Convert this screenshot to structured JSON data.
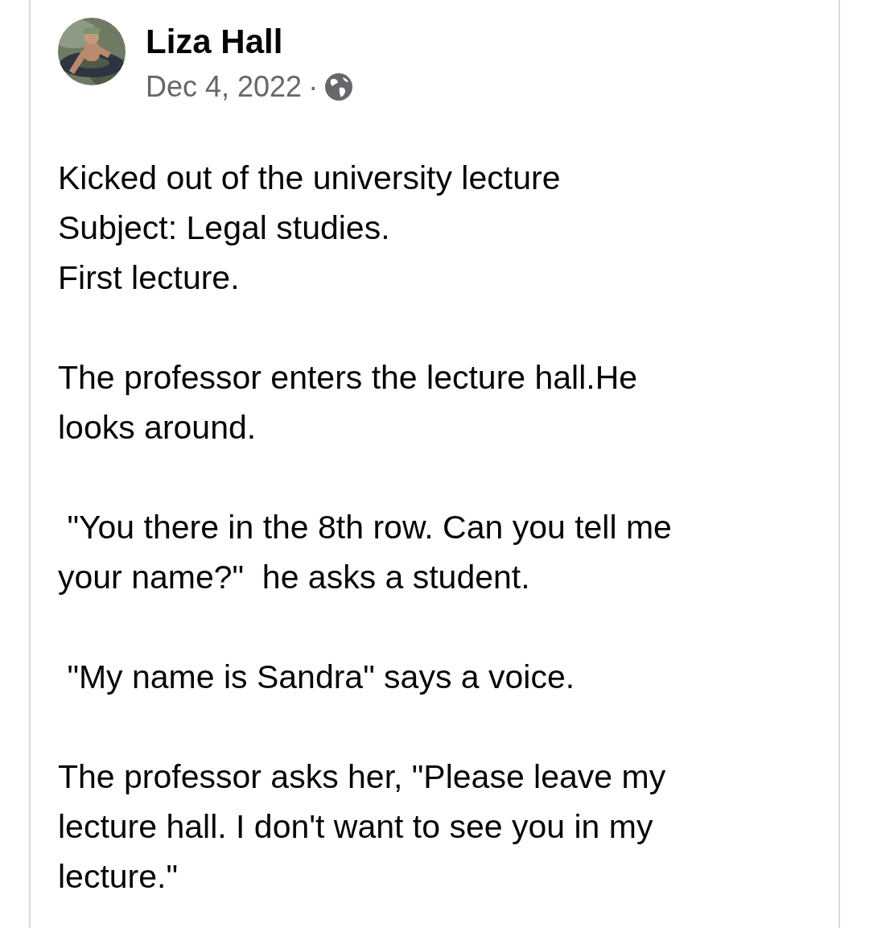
{
  "post": {
    "author": {
      "name": "Liza Hall"
    },
    "date": "Dec 4, 2022",
    "separator": "·",
    "public": true,
    "paragraphs": [
      {
        "lines": [
          "Kicked out of the university lecture",
          "Subject: Legal studies.",
          "First lecture."
        ]
      },
      {
        "lines": [
          "The professor enters the lecture hall.He",
          "looks around."
        ]
      },
      {
        "lines": [
          " \"You there in the 8th row. Can you tell me",
          "your name?\"  he asks a student."
        ]
      },
      {
        "lines": [
          " \"My name is Sandra\" says a voice."
        ]
      },
      {
        "lines": [
          "The professor asks her, \"Please leave my",
          "lecture hall. I don't want to see you in my",
          "lecture.\""
        ]
      }
    ]
  }
}
